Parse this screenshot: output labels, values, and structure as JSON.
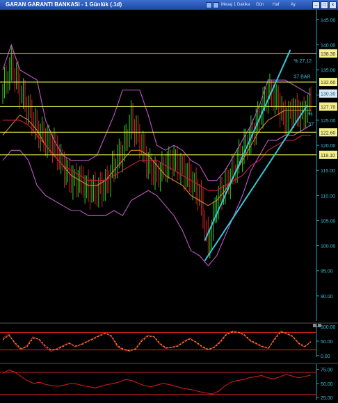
{
  "window": {
    "title": "GARAN GARANTI BANKASI - 1 Günlük (.1d)",
    "toolbar_texts": [
      "Mesaj",
      "1 Dakika",
      "Gün",
      "Haf",
      "Ay"
    ]
  },
  "chart_data": [
    {
      "type": "candlestick",
      "title": "GARAN GARANTI BANKASI - 1 Günlük (.1d)",
      "ylim": [
        85,
        147
      ],
      "yticks": [
        90,
        95,
        100,
        105,
        110,
        115,
        120,
        125,
        130,
        135,
        140,
        145
      ],
      "ytick_labels": [
        "90.00",
        "95.00",
        "100.00",
        "105.00",
        "110.00",
        "115.00",
        "120.00",
        "125.00",
        "130.00",
        "135.00",
        "140.00",
        "145.00"
      ],
      "horizontal_levels": [
        138.3,
        132.6,
        127.7,
        122.6,
        118.1
      ],
      "level_labels": [
        "138.30",
        "132.60",
        "127.70",
        "122.60",
        "118.10"
      ],
      "last_price": 130.3,
      "last_price_label": "130.30",
      "channel_labels": [
        "% 27.12",
        "37 BAR",
        "%",
        "37"
      ],
      "close_path": [
        [
          0,
          131
        ],
        [
          5,
          136
        ],
        [
          10,
          131
        ],
        [
          15,
          127
        ],
        [
          20,
          123
        ],
        [
          25,
          121
        ],
        [
          30,
          120
        ],
        [
          35,
          116
        ],
        [
          40,
          113
        ],
        [
          45,
          113
        ],
        [
          50,
          111
        ],
        [
          55,
          111
        ],
        [
          60,
          112
        ],
        [
          65,
          116
        ],
        [
          70,
          119
        ],
        [
          75,
          125
        ],
        [
          80,
          121
        ],
        [
          85,
          116
        ],
        [
          90,
          114
        ],
        [
          95,
          116
        ],
        [
          100,
          117
        ],
        [
          105,
          115
        ],
        [
          110,
          113
        ],
        [
          115,
          110
        ],
        [
          120,
          100
        ],
        [
          125,
          109
        ],
        [
          130,
          112
        ],
        [
          135,
          115
        ],
        [
          140,
          119
        ],
        [
          145,
          122
        ],
        [
          150,
          126
        ],
        [
          155,
          131
        ],
        [
          160,
          129
        ],
        [
          165,
          125
        ],
        [
          170,
          127
        ],
        [
          175,
          126
        ],
        [
          180,
          129
        ]
      ],
      "bollinger_upper": [
        [
          0,
          135
        ],
        [
          5,
          140
        ],
        [
          10,
          135
        ],
        [
          15,
          134
        ],
        [
          20,
          133
        ],
        [
          25,
          125
        ],
        [
          30,
          121
        ],
        [
          35,
          118
        ],
        [
          40,
          117
        ],
        [
          45,
          117
        ],
        [
          50,
          117
        ],
        [
          55,
          118
        ],
        [
          60,
          122
        ],
        [
          65,
          126
        ],
        [
          70,
          131
        ],
        [
          75,
          131
        ],
        [
          80,
          131
        ],
        [
          85,
          126
        ],
        [
          90,
          120
        ],
        [
          95,
          119
        ],
        [
          100,
          120
        ],
        [
          105,
          119
        ],
        [
          110,
          117
        ],
        [
          115,
          116
        ],
        [
          120,
          113
        ],
        [
          125,
          113
        ],
        [
          130,
          115
        ],
        [
          135,
          118
        ],
        [
          140,
          121
        ],
        [
          145,
          124
        ],
        [
          150,
          128
        ],
        [
          155,
          133
        ],
        [
          160,
          133
        ],
        [
          165,
          133
        ],
        [
          170,
          132
        ],
        [
          175,
          131
        ],
        [
          180,
          130
        ]
      ],
      "bollinger_lower": [
        [
          0,
          117
        ],
        [
          5,
          119
        ],
        [
          10,
          119
        ],
        [
          15,
          117
        ],
        [
          20,
          112
        ],
        [
          25,
          110
        ],
        [
          30,
          109
        ],
        [
          35,
          108
        ],
        [
          40,
          107
        ],
        [
          45,
          107
        ],
        [
          50,
          106
        ],
        [
          55,
          106
        ],
        [
          60,
          106
        ],
        [
          65,
          107
        ],
        [
          70,
          106
        ],
        [
          75,
          109
        ],
        [
          80,
          110
        ],
        [
          85,
          111
        ],
        [
          90,
          110
        ],
        [
          95,
          108
        ],
        [
          100,
          106
        ],
        [
          105,
          103
        ],
        [
          110,
          99
        ],
        [
          115,
          98
        ],
        [
          120,
          96
        ],
        [
          125,
          98
        ],
        [
          130,
          102
        ],
        [
          135,
          106
        ],
        [
          140,
          110
        ],
        [
          145,
          115
        ],
        [
          150,
          118
        ],
        [
          155,
          121
        ],
        [
          160,
          121
        ],
        [
          165,
          122
        ],
        [
          170,
          122
        ],
        [
          175,
          123
        ],
        [
          180,
          124
        ]
      ],
      "ma_orange": [
        [
          0,
          122
        ],
        [
          5,
          124
        ],
        [
          10,
          126
        ],
        [
          15,
          125
        ],
        [
          20,
          123
        ],
        [
          25,
          120
        ],
        [
          30,
          118
        ],
        [
          35,
          116
        ],
        [
          40,
          114
        ],
        [
          45,
          113
        ],
        [
          50,
          112
        ],
        [
          55,
          112
        ],
        [
          60,
          113
        ],
        [
          65,
          115
        ],
        [
          70,
          117
        ],
        [
          75,
          119
        ],
        [
          80,
          119
        ],
        [
          85,
          118
        ],
        [
          90,
          116
        ],
        [
          95,
          114
        ],
        [
          100,
          113
        ],
        [
          105,
          112
        ],
        [
          110,
          110
        ],
        [
          115,
          109
        ],
        [
          120,
          108
        ],
        [
          125,
          109
        ],
        [
          130,
          111
        ],
        [
          135,
          114
        ],
        [
          140,
          117
        ],
        [
          145,
          120
        ],
        [
          150,
          123
        ],
        [
          155,
          125
        ],
        [
          160,
          126
        ],
        [
          165,
          127
        ],
        [
          170,
          127
        ],
        [
          175,
          127
        ],
        [
          180,
          127
        ]
      ],
      "ma_red": [
        [
          0,
          125
        ],
        [
          5,
          125
        ],
        [
          10,
          125
        ],
        [
          15,
          124
        ],
        [
          20,
          122
        ],
        [
          25,
          120
        ],
        [
          30,
          118
        ],
        [
          35,
          116
        ],
        [
          40,
          115
        ],
        [
          45,
          114
        ],
        [
          50,
          113
        ],
        [
          55,
          113
        ],
        [
          60,
          113
        ],
        [
          65,
          114
        ],
        [
          70,
          115
        ],
        [
          75,
          116
        ],
        [
          80,
          117
        ],
        [
          85,
          117
        ],
        [
          90,
          117
        ],
        [
          95,
          116
        ],
        [
          100,
          115
        ],
        [
          105,
          114
        ],
        [
          110,
          113
        ],
        [
          115,
          112
        ],
        [
          120,
          111
        ],
        [
          125,
          111
        ],
        [
          130,
          112
        ],
        [
          135,
          113
        ],
        [
          140,
          114
        ],
        [
          145,
          116
        ],
        [
          150,
          117
        ],
        [
          155,
          119
        ],
        [
          160,
          120
        ],
        [
          165,
          121
        ],
        [
          170,
          121
        ],
        [
          175,
          122
        ],
        [
          180,
          122
        ]
      ],
      "channel_line_1": [
        [
          118,
          101
        ],
        [
          168,
          139
        ]
      ],
      "channel_line_2": [
        [
          118,
          97
        ],
        [
          178,
          128
        ]
      ]
    },
    {
      "type": "line",
      "ylim": [
        -5,
        105
      ],
      "yticks": [
        0,
        50,
        100
      ],
      "ytick_labels": [
        "0.00",
        "50.00",
        "100.00"
      ],
      "levels": [
        80,
        20
      ],
      "series": [
        {
          "values": [
            60,
            75,
            40,
            20,
            35,
            65,
            55,
            30,
            15,
            25,
            35,
            45,
            30,
            40,
            50,
            60,
            70,
            80,
            65,
            30,
            20,
            15,
            25,
            55,
            70,
            65,
            40,
            25,
            30,
            35,
            50,
            60,
            45,
            30,
            20,
            30,
            50,
            75,
            85,
            80,
            70,
            50,
            40,
            30,
            25,
            60,
            85,
            75,
            65,
            40,
            30,
            50
          ]
        },
        {
          "values": [
            55,
            70,
            45,
            25,
            30,
            60,
            58,
            35,
            20,
            22,
            32,
            42,
            33,
            38,
            48,
            58,
            68,
            77,
            68,
            35,
            22,
            17,
            23,
            50,
            67,
            66,
            43,
            27,
            28,
            33,
            47,
            58,
            47,
            32,
            22,
            28,
            46,
            72,
            82,
            81,
            72,
            53,
            42,
            32,
            27,
            55,
            82,
            77,
            67,
            43,
            32,
            47
          ]
        }
      ]
    },
    {
      "type": "line",
      "ylim": [
        20,
        82
      ],
      "yticks": [
        25,
        50,
        75
      ],
      "ytick_labels": [
        "25.00",
        "50.00",
        "75.00"
      ],
      "levels": [
        70,
        30
      ],
      "series": [
        {
          "values": [
            68,
            74,
            70,
            62,
            55,
            50,
            52,
            48,
            46,
            45,
            47,
            50,
            49,
            46,
            44,
            42,
            45,
            48,
            50,
            53,
            57,
            55,
            50,
            46,
            44,
            47,
            50,
            48,
            45,
            42,
            40,
            38,
            35,
            33,
            31,
            36,
            45,
            52,
            55,
            57,
            60,
            62,
            64,
            60,
            58,
            62,
            66,
            63,
            60,
            62,
            65
          ]
        }
      ]
    }
  ]
}
